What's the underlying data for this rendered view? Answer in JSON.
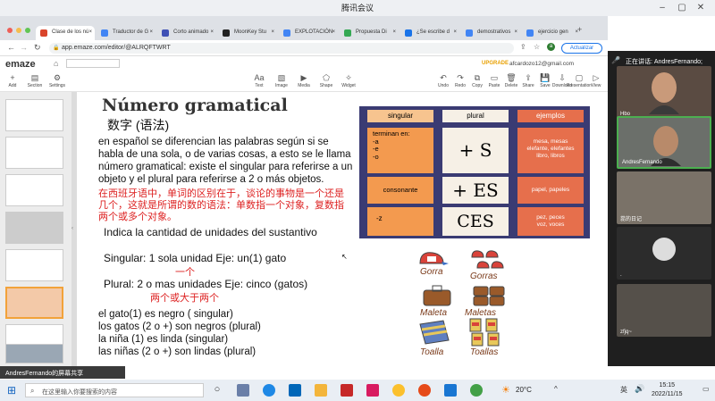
{
  "meeting": {
    "title": "腾讯会议"
  },
  "browser": {
    "tabs": [
      {
        "label": "Clase de los nú",
        "color": "#d9442b"
      },
      {
        "label": "Traductor de G",
        "color": "#4285f4"
      },
      {
        "label": "Corto animado",
        "color": "#3f51b5"
      },
      {
        "label": "MoonKey Stu",
        "color": "#222222"
      },
      {
        "label": "EXPLOTACIÓN",
        "color": "#4285f4"
      },
      {
        "label": "Propuesta Di",
        "color": "#34a853"
      },
      {
        "label": "¿Se escribe d",
        "color": "#1a73e8"
      },
      {
        "label": "demostrativos",
        "color": "#4285f4"
      },
      {
        "label": "ejercicio gen",
        "color": "#4285f4"
      }
    ],
    "url": "app.emaze.com/editor/@ALRQFTWRT",
    "update_label": "Actualizar"
  },
  "emaze": {
    "logo": "emaze",
    "upgrade": "UPGRADE",
    "email": "afcardozo12@gmail.com",
    "left_tools": [
      {
        "label": "Add",
        "icon": "+"
      },
      {
        "label": "Section",
        "icon": "▤"
      },
      {
        "label": "Settings",
        "icon": "⚙"
      }
    ],
    "tools": [
      {
        "label": "Text",
        "icon": "Aa"
      },
      {
        "label": "Image",
        "icon": "▧"
      },
      {
        "label": "Media",
        "icon": "▶"
      },
      {
        "label": "Shape",
        "icon": "⬠"
      },
      {
        "label": "Widget",
        "icon": "✧"
      }
    ],
    "right_tools": [
      {
        "label": "Undo",
        "icon": "↶"
      },
      {
        "label": "Redo",
        "icon": "↷"
      },
      {
        "label": "Copy",
        "icon": "⧉"
      },
      {
        "label": "Paste",
        "icon": "▭"
      },
      {
        "label": "Delete",
        "icon": "🗑"
      },
      {
        "label": "Share",
        "icon": "⇪"
      },
      {
        "label": "Save",
        "icon": "💾"
      },
      {
        "label": "Download",
        "icon": "⇩"
      },
      {
        "label": "Presentation",
        "icon": "▢"
      },
      {
        "label": "View",
        "icon": "▷"
      }
    ]
  },
  "slide": {
    "title": "Número gramatical",
    "subtitle_zh": "数字 (语法)",
    "intro_es": [
      "en español se diferencian las palabras según si se",
      "habla de una sola, o de varias cosas, a esto se le llama",
      "número gramatical: existe el singular para referirse a un",
      "objeto y el plural para referirse a 2 o más objetos."
    ],
    "intro_zh": [
      "在西班牙语中，单词的区别在于，谈论的事物是一个还是",
      "几个，这就是所谓的数的语法：单数指一个对象，复数指",
      "两个或多个对象。"
    ],
    "indica": "Indica la cantidad de unidades del sustantivo",
    "singular_line": "Singular:  1 sola unidad Eje: un(1) gato",
    "singular_zh": "一个",
    "plural_line": "Plural: 2 o mas unidades Eje: cinco (gatos)",
    "plural_zh": "两个或大于两个",
    "examples": [
      "el gato(1) es negro ( singular)",
      "los gatos (2 o +) son negros (plural)",
      "la niña (1) es linda (singular)",
      "las niñas (2 o +)  son lindas (plural)"
    ],
    "table": {
      "headers": [
        "singular",
        "plural",
        "ejemplos"
      ],
      "rows": [
        {
          "singular": "terminan en:\n-a\n-e\n-o",
          "plural": "+ S",
          "ejemplos": "mesa, mesas\nelefante, elefantes\nlibro, libros"
        },
        {
          "singular": "consonante",
          "plural": "+ ES",
          "ejemplos": "papel, papeles"
        },
        {
          "singular": "-z",
          "plural": "CES",
          "ejemplos": "pez, peces\nvoz, voces"
        }
      ]
    },
    "drawings": [
      {
        "label": "Gorra"
      },
      {
        "label": "Gorras"
      },
      {
        "label": "Maleta"
      },
      {
        "label": "Maletas"
      },
      {
        "label": "Toalla"
      },
      {
        "label": "Toallas"
      }
    ]
  },
  "zoom": {
    "speaking": "正在讲话: AndresFernando;",
    "participants": [
      {
        "name": "Hbo"
      },
      {
        "name": "AndresFernando"
      },
      {
        "name": "蕊的日记"
      },
      {
        "name": "."
      },
      {
        "name": "zfjq~"
      }
    ],
    "share_banner": "AndresFernando的屏幕共享"
  },
  "taskbar": {
    "search_placeholder": "在这里输入你要搜索的内容",
    "temperature": "20°C",
    "ime": "英",
    "time": "15:15",
    "date": "2022/11/15"
  }
}
